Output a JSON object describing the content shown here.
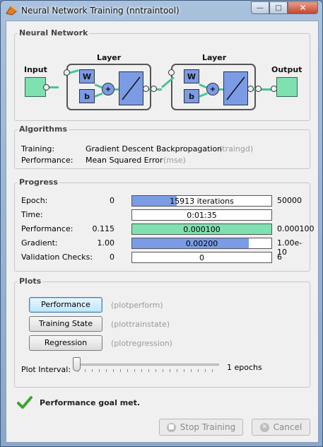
{
  "window": {
    "title": "Neural Network Training (nntraintool)",
    "minimize_glyph": "—",
    "maximize_glyph": "□",
    "close_glyph": "✕"
  },
  "network": {
    "group_title": "Neural Network",
    "input_label": "Input",
    "output_label": "Output",
    "layers": [
      {
        "label": "Layer",
        "w": "W",
        "b": "b",
        "sum": "+"
      },
      {
        "label": "Layer",
        "w": "W",
        "b": "b",
        "sum": "+"
      }
    ]
  },
  "algorithms": {
    "group_title": "Algorithms",
    "rows": [
      {
        "label": "Training:",
        "value": "Gradient Descent Backpropagation",
        "code": "(traingd)"
      },
      {
        "label": "Performance:",
        "value": "Mean Squared Error",
        "code": "(mse)"
      }
    ]
  },
  "progress": {
    "group_title": "Progress",
    "rows": [
      {
        "label": "Epoch:",
        "left": "0",
        "bar_text": "15913 iterations",
        "right": "50000",
        "fill_fraction": 0.32,
        "color": "#7b9be5"
      },
      {
        "label": "Time:",
        "left": "",
        "bar_text": "0:01:35",
        "right": "",
        "fill_fraction": 0,
        "color": "#7b9be5"
      },
      {
        "label": "Performance:",
        "left": "0.115",
        "bar_text": "0.000100",
        "right": "0.000100",
        "fill_fraction": 1.0,
        "color": "#7fe0b0"
      },
      {
        "label": "Gradient:",
        "left": "1.00",
        "bar_text": "0.00200",
        "right": "1.00e-10",
        "fill_fraction": 0.84,
        "color": "#7b9be5"
      },
      {
        "label": "Validation Checks:",
        "left": "0",
        "bar_text": "0",
        "right": "6",
        "fill_fraction": 0,
        "color": "#7b9be5"
      }
    ]
  },
  "plots": {
    "group_title": "Plots",
    "buttons": [
      {
        "label": "Performance",
        "fn": "(plotperform)"
      },
      {
        "label": "Training State",
        "fn": "(plottrainstate)"
      },
      {
        "label": "Regression",
        "fn": "(plotregression)"
      }
    ],
    "interval_label": "Plot Interval:",
    "interval_value": "1 epochs",
    "interval_level": 0
  },
  "status": {
    "message": "Performance goal met.",
    "icon": "checkmark-icon",
    "icon_color": "#3aa62b"
  },
  "footer": {
    "stop_label": "Stop Training",
    "cancel_label": "Cancel"
  }
}
